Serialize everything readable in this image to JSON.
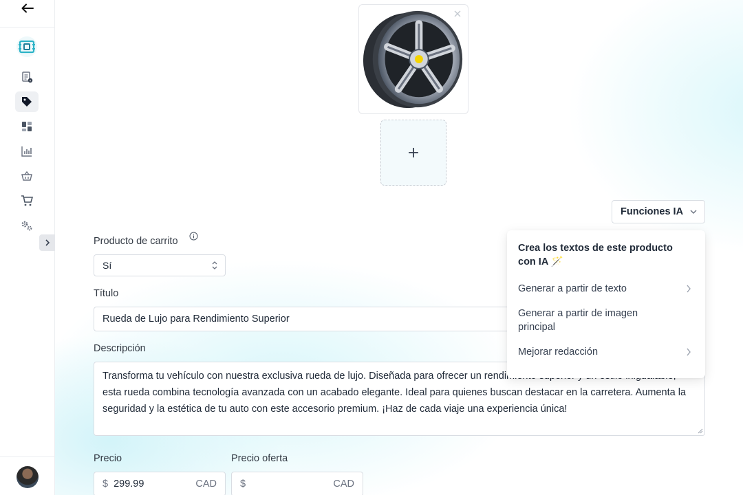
{
  "sidebar": {
    "items": [
      {
        "icon": "document-info-icon",
        "active": false
      },
      {
        "icon": "tag-icon",
        "active": true
      },
      {
        "icon": "dashboard-icon",
        "active": false
      },
      {
        "icon": "bar-chart-icon",
        "active": false
      },
      {
        "icon": "basket-icon",
        "active": false
      },
      {
        "icon": "cart-icon",
        "active": false
      },
      {
        "icon": "gears-icon",
        "active": false
      }
    ]
  },
  "images": {
    "main_image": "wheel-rim-icon",
    "add_symbol": "+"
  },
  "ai": {
    "button_label": "Funciones IA",
    "menu_title": "Crea los textos de este producto con IA 🪄",
    "items": [
      {
        "label": "Generar a partir de texto",
        "has_submenu": true
      },
      {
        "label": "Generar a partir de imagen principal",
        "has_submenu": false
      },
      {
        "label": "Mejorar redacción",
        "has_submenu": true
      }
    ]
  },
  "form": {
    "cart_product_label": "Producto de carrito",
    "cart_product_value": "Sí",
    "title_label": "Título",
    "title_value": "Rueda de Lujo para Rendimiento Superior",
    "description_label": "Descripción",
    "description_value": "Transforma tu vehículo con nuestra exclusiva rueda de lujo. Diseñada para ofrecer un rendimiento superior y un estilo inigualable, esta rueda combina tecnología avanzada con un acabado elegante. Ideal para quienes buscan destacar en la carretera. Aumenta la seguridad y la estética de tu auto con este accesorio premium. ¡Haz de cada viaje una experiencia única!",
    "price_label": "Precio",
    "price_currency_symbol": "$",
    "price_value": "299.99",
    "price_unit": "CAD",
    "sale_price_label": "Precio oferta",
    "sale_price_currency_symbol": "$",
    "sale_price_value": "",
    "sale_price_unit": "CAD"
  }
}
